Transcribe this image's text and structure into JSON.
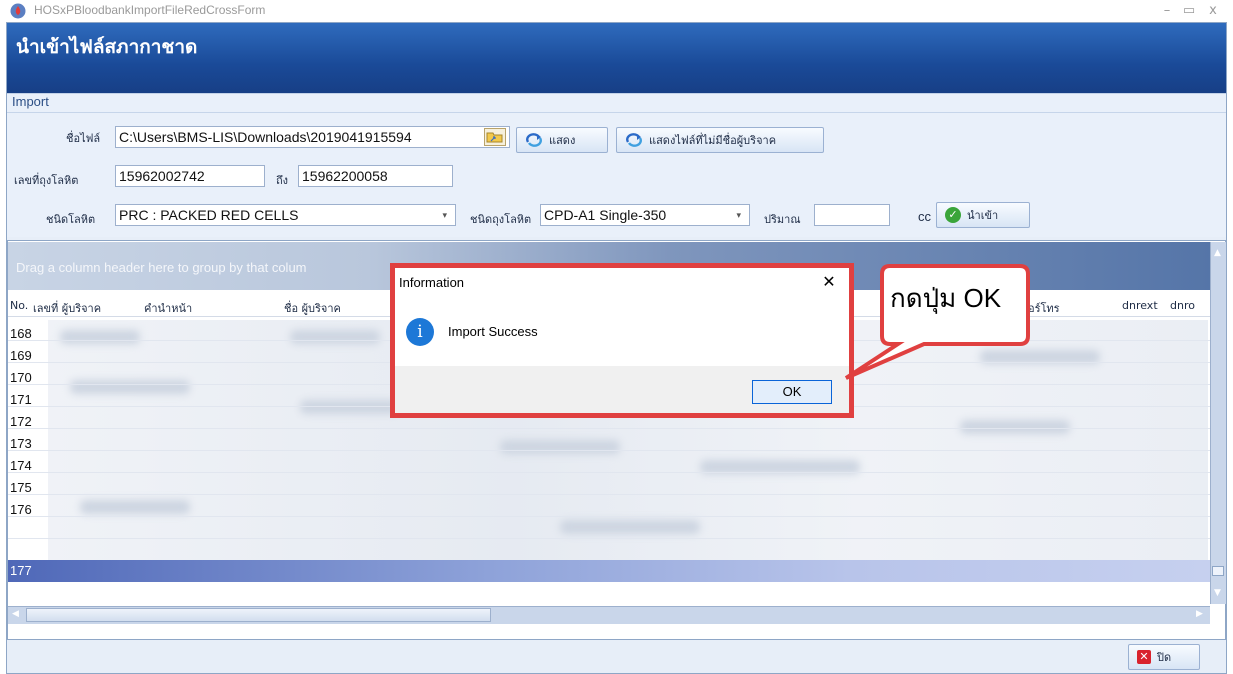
{
  "window": {
    "title": "HOSxPBloodbankImportFileRedCrossForm",
    "min_glyph": "–",
    "max_glyph": "▭",
    "close_glyph": "x"
  },
  "form": {
    "title": "นำเข้าไฟล์สภากาชาด",
    "group_caption": "Import"
  },
  "import": {
    "file_label": "ชื่อไฟล์",
    "file_value": "C:\\Users\\BMS-LIS\\Downloads\\2019041915594",
    "show_button": "แสดง",
    "show_no_donor_button": "แสดงไฟล์ที่ไม่มีชื่อผู้บริจาค",
    "bag_no_label": "เลขที่ถุงโลหิต",
    "bag_from": "15962002742",
    "to_label": "ถึง",
    "bag_to": "15962200058",
    "blood_type_label": "ชนิดโลหิต",
    "blood_type_value": "PRC : PACKED RED CELLS",
    "bag_type_label": "ชนิดถุงโลหิต",
    "bag_type_value": "CPD-A1 Single-350",
    "volume_label": "ปริมาณ",
    "volume_value": "",
    "volume_unit": "cc",
    "import_button": "นำเข้า"
  },
  "grid": {
    "group_hint": "Drag a column header here to group by that colum",
    "columns": [
      "No.",
      "เลขที่ ผู้บริจาค",
      "คำนำหน้า",
      "ชื่อ ผู้บริจาค",
      "อร์โทร",
      "dnrext",
      "dnro"
    ],
    "row_numbers": [
      "168",
      "169",
      "170",
      "171",
      "172",
      "173",
      "174",
      "175",
      "176",
      "177"
    ]
  },
  "dialog": {
    "title": "Information",
    "close_glyph": "✕",
    "message": "Import Success",
    "ok_label": "OK"
  },
  "callout": {
    "text": "กดปุ่ม OK"
  },
  "footer": {
    "close_label": "ปิด"
  },
  "colors": {
    "header_band": "#1a4a98",
    "dialog_outline": "#e04040",
    "info_icon": "#1d78d7",
    "selected_row": "#4f68b8"
  }
}
